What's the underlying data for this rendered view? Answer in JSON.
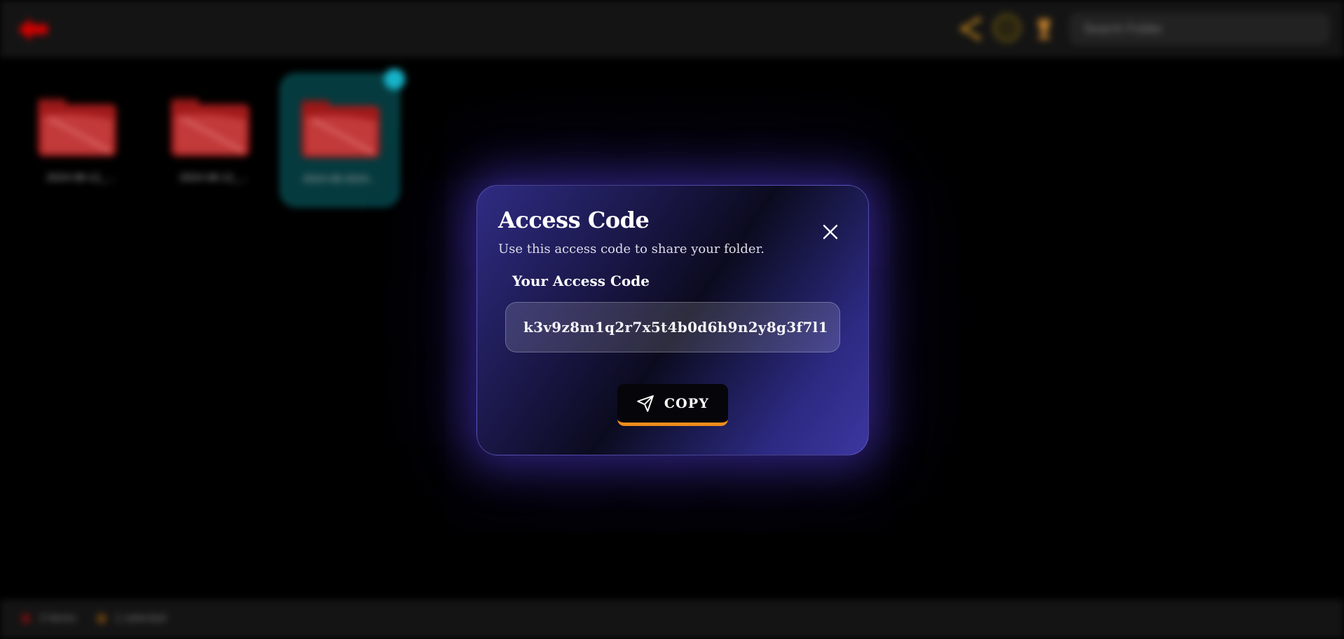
{
  "header": {
    "search_placeholder": "Search Folder"
  },
  "folders": [
    {
      "name": "2024-08-12_..."
    },
    {
      "name": "2024-08-12_..."
    },
    {
      "name": "2024-08-2024..."
    }
  ],
  "footer": {
    "items": [
      {
        "label": "3 Items",
        "icon": "red-dot-icon"
      },
      {
        "label": "1 selected",
        "icon": "orange-dot-icon"
      }
    ]
  },
  "modal": {
    "title": "Access Code",
    "subtitle": "Use this access code to share your folder.",
    "field_label": "Your Access Code",
    "access_code": "k3v9z8m1q2r7x5t4b0d6h9n2y8g3f7l1",
    "copy_label": "COPY"
  },
  "colors": {
    "accent_orange": "#f08d1b",
    "modal_purple": "#2f2c84",
    "brand_red": "#d40000",
    "teal_selected": "#17b3c9"
  }
}
